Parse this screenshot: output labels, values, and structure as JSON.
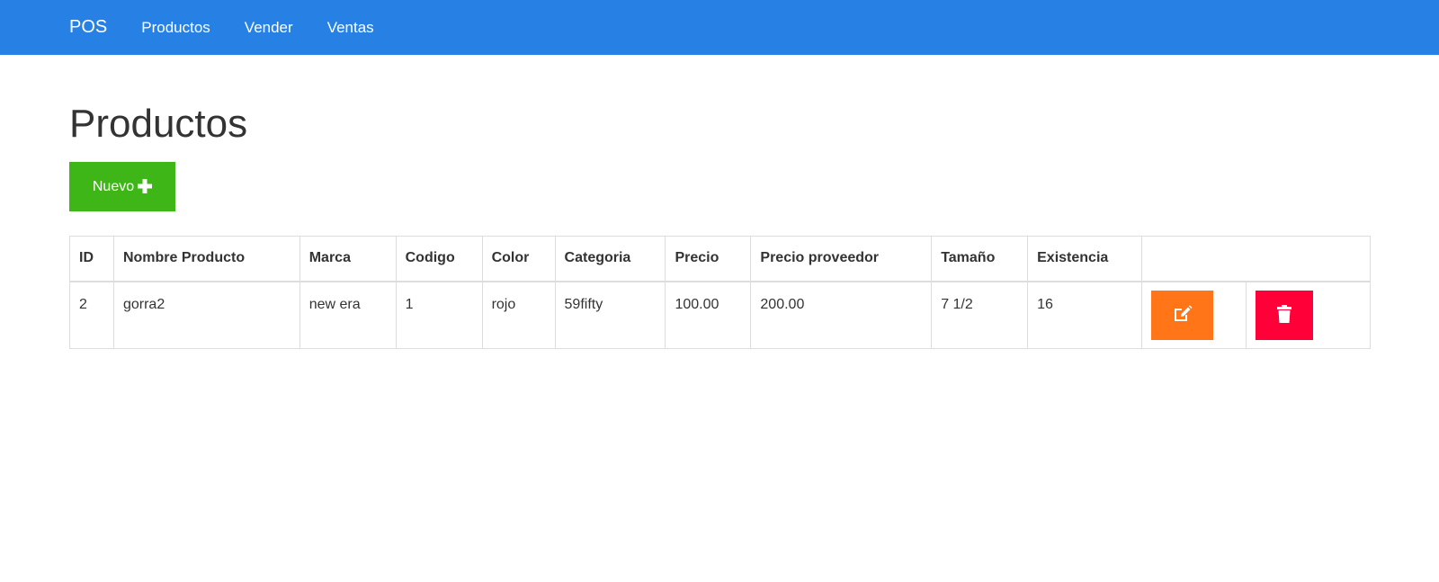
{
  "navbar": {
    "brand": "POS",
    "links": [
      "Productos",
      "Vender",
      "Ventas"
    ]
  },
  "page": {
    "title": "Productos",
    "new_button_label": "Nuevo"
  },
  "table": {
    "headers": [
      "ID",
      "Nombre Producto",
      "Marca",
      "Codigo",
      "Color",
      "Categoria",
      "Precio",
      "Precio proveedor",
      "Tamaño",
      "Existencia"
    ],
    "rows": [
      {
        "id": "2",
        "name": "gorra2",
        "brand": "new era",
        "code": "1",
        "color": "rojo",
        "category": "59fifty",
        "price": "100.00",
        "supplier_price": "200.00",
        "size": "7 1/2",
        "stock": "16"
      }
    ]
  },
  "icons": {
    "edit": "edit-icon",
    "delete": "trash-icon",
    "new": "plus-icon"
  },
  "colors": {
    "navbar": "#2780e3",
    "new_button": "#3fb618",
    "edit_button": "#ff7518",
    "delete_button": "#ff0039"
  }
}
